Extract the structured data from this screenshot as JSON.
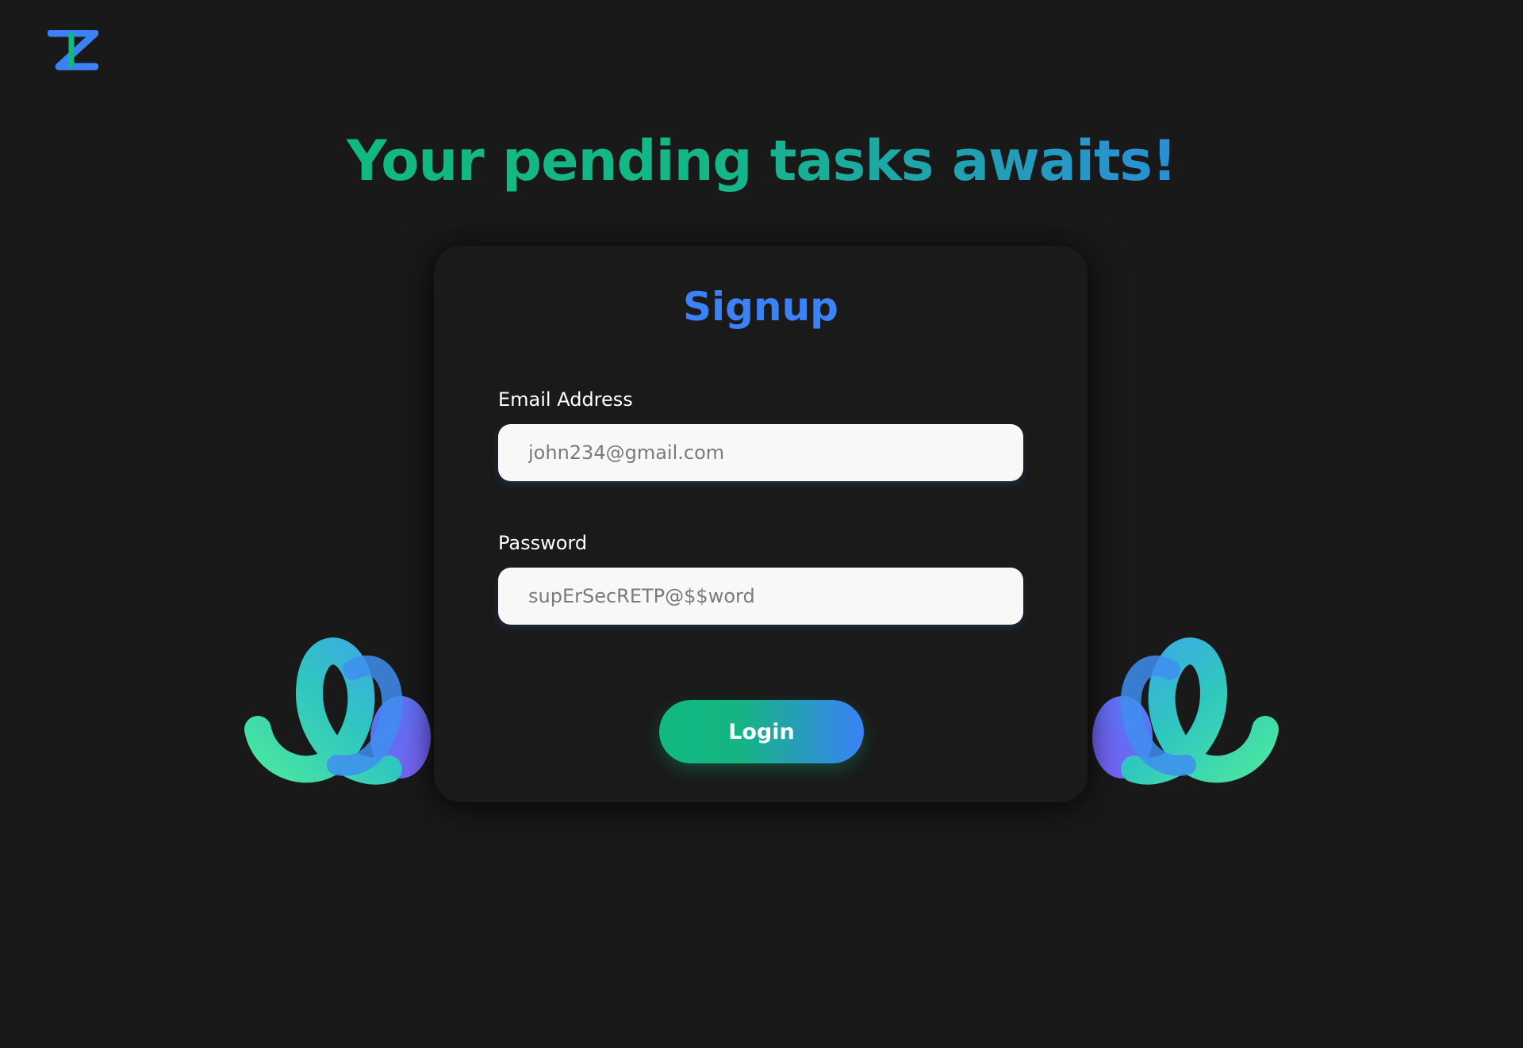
{
  "page": {
    "headline": "Your pending tasks awaits!"
  },
  "signup_card": {
    "title": "Signup",
    "email": {
      "label": "Email Address",
      "placeholder": "john234@gmail.com"
    },
    "password": {
      "label": "Password",
      "placeholder": "supErSecRETP@$$word"
    },
    "login_button": "Login"
  },
  "icons": {
    "logo": "z-logo-icon",
    "decoration": "swirl-3d-icon"
  },
  "colors": {
    "background": "#191919",
    "accent_green": "#10b981",
    "accent_blue": "#3b82f6",
    "input_background": "#f8f8f8"
  }
}
